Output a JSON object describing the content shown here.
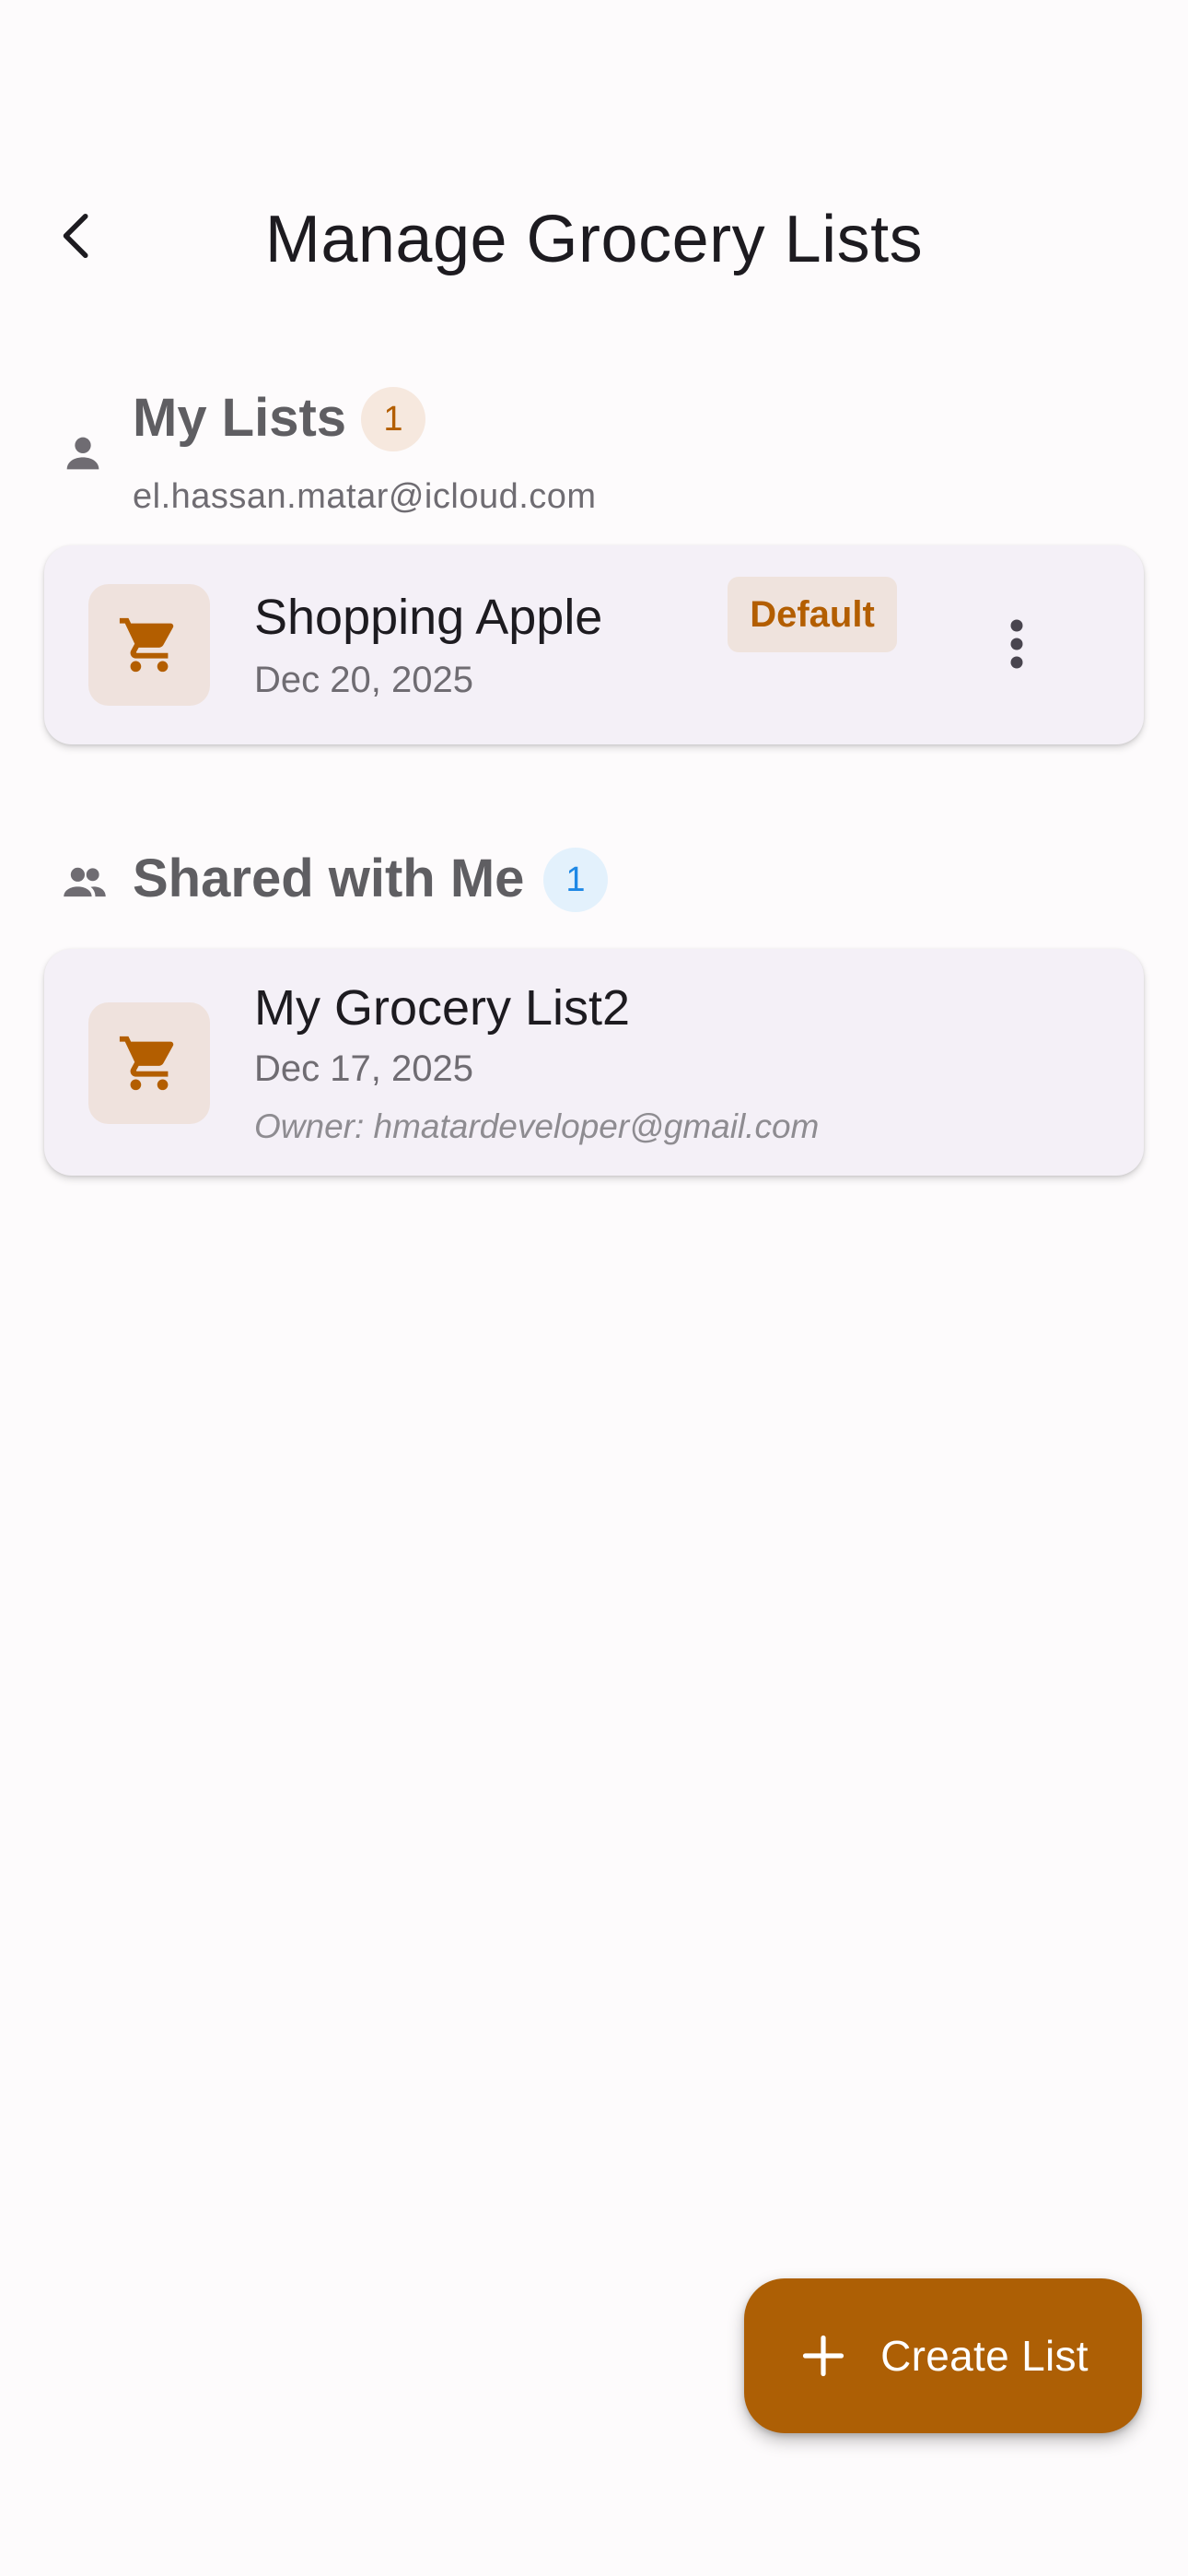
{
  "header": {
    "title": "Manage Grocery Lists",
    "back_icon": "chevron-left-icon"
  },
  "my_lists": {
    "title": "My Lists",
    "count": "1",
    "email": "el.hassan.matar@icloud.com",
    "icon": "person-icon",
    "items": [
      {
        "name": "Shopping Apple",
        "date": "Dec 20, 2025",
        "badge": "Default",
        "icon": "shopping-cart-icon",
        "menu_icon": "more-vert-icon"
      }
    ]
  },
  "shared_lists": {
    "title": "Shared with Me",
    "count": "1",
    "icon": "people-icon",
    "items": [
      {
        "name": "My Grocery List2",
        "date": "Dec 17, 2025",
        "owner": "Owner: hmatardeveloper@gmail.com",
        "icon": "shopping-cart-icon"
      }
    ]
  },
  "fab": {
    "label": "Create List",
    "icon": "plus-icon"
  },
  "colors": {
    "accent": "#ad5f05",
    "accent_text": "#b35e00",
    "card_bg": "#f4f0f7",
    "badge_orange_bg": "#f6e8de",
    "badge_blue_bg": "#e3f1fc",
    "badge_blue_text": "#1e88e5"
  }
}
